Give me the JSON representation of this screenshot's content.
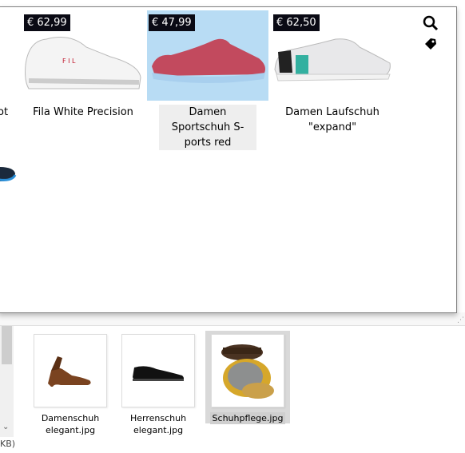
{
  "products": [
    {
      "price": "€ 62,99",
      "title": "Fila White Precision"
    },
    {
      "price": "€ 47,99",
      "title": "Damen Sportschuh S-ports red",
      "selected": true
    },
    {
      "price": "€ 62,50",
      "title": "Damen Laufschuh \"expand\""
    }
  ],
  "partial_left_title": "ot",
  "icons": {
    "search": "search-icon",
    "tag": "tag-icon"
  },
  "files": [
    {
      "name": "Damenschuh elegant.jpg"
    },
    {
      "name": "Herrenschuh elegant.jpg"
    },
    {
      "name": "Schuhpflege.jpg",
      "selected": true
    }
  ],
  "status": {
    "size_fragment": "KB)"
  },
  "colors": {
    "selection": "#b8dcf4",
    "price_bg": "#0a0a14"
  }
}
